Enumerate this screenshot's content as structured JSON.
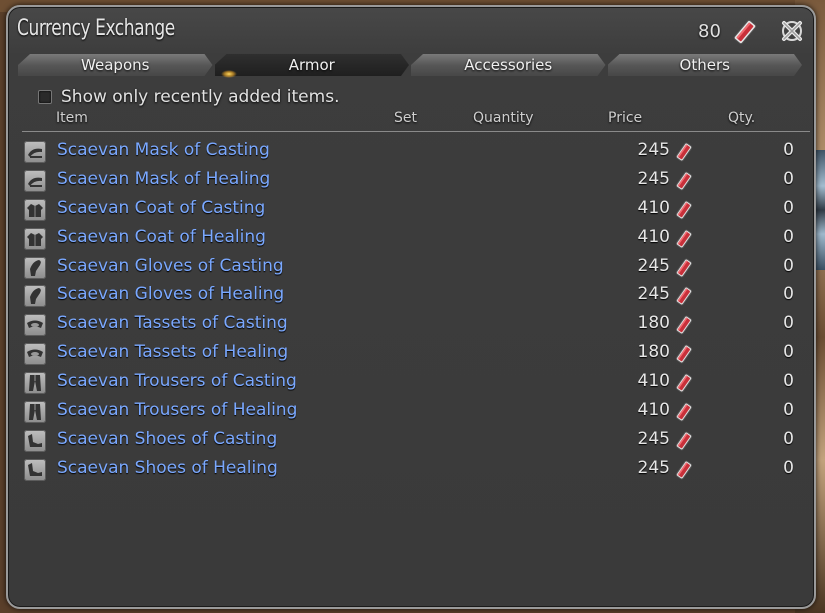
{
  "window": {
    "title": "Currency Exchange",
    "currency_count": "80"
  },
  "tabs": [
    {
      "label": "Weapons",
      "active": false
    },
    {
      "label": "Armor",
      "active": true
    },
    {
      "label": "Accessories",
      "active": false
    },
    {
      "label": "Others",
      "active": false
    }
  ],
  "filter": {
    "label": "Show only recently added items.",
    "checked": false
  },
  "columns": {
    "item": "Item",
    "set": "Set",
    "quantity": "Quantity",
    "price": "Price",
    "qty": "Qty."
  },
  "items": [
    {
      "name": "Scaevan Mask of Casting",
      "price": "245",
      "qty": "0",
      "icon": "mask-icon"
    },
    {
      "name": "Scaevan Mask of Healing",
      "price": "245",
      "qty": "0",
      "icon": "mask-icon"
    },
    {
      "name": "Scaevan Coat of Casting",
      "price": "410",
      "qty": "0",
      "icon": "coat-icon"
    },
    {
      "name": "Scaevan Coat of Healing",
      "price": "410",
      "qty": "0",
      "icon": "coat-icon"
    },
    {
      "name": "Scaevan Gloves of Casting",
      "price": "245",
      "qty": "0",
      "icon": "gloves-icon"
    },
    {
      "name": "Scaevan Gloves of Healing",
      "price": "245",
      "qty": "0",
      "icon": "gloves-icon"
    },
    {
      "name": "Scaevan Tassets of Casting",
      "price": "180",
      "qty": "0",
      "icon": "tassets-icon"
    },
    {
      "name": "Scaevan Tassets of Healing",
      "price": "180",
      "qty": "0",
      "icon": "tassets-icon"
    },
    {
      "name": "Scaevan Trousers of Casting",
      "price": "410",
      "qty": "0",
      "icon": "trousers-icon"
    },
    {
      "name": "Scaevan Trousers of Healing",
      "price": "410",
      "qty": "0",
      "icon": "trousers-icon"
    },
    {
      "name": "Scaevan Shoes of Casting",
      "price": "245",
      "qty": "0",
      "icon": "shoes-icon"
    },
    {
      "name": "Scaevan Shoes of Healing",
      "price": "245",
      "qty": "0",
      "icon": "shoes-icon"
    }
  ],
  "colors": {
    "item_link": "#7aa8ff",
    "tomestone": "#c8303a"
  }
}
